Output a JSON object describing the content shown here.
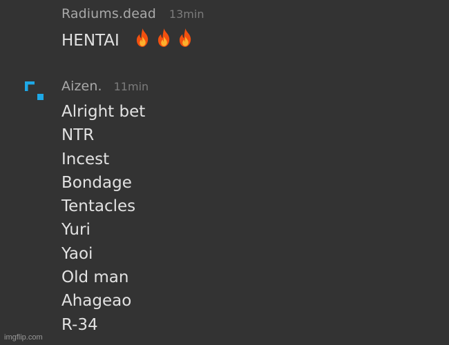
{
  "messages": [
    {
      "author": "Radiums.dead",
      "time": "13min",
      "text": "HENTAI",
      "emoji_icons": [
        "fire-icon",
        "fire-icon",
        "fire-icon"
      ]
    },
    {
      "author": "Aizen.",
      "time": "11min",
      "avatar_icon": "pixel-logo-icon",
      "lines": [
        "Alright bet",
        "NTR",
        "Incest",
        "Bondage",
        "Tentacles",
        "Yuri",
        "Yaoi",
        "Old man",
        "Ahageao",
        "R-34"
      ]
    }
  ],
  "watermark": "imgflip.com",
  "colors": {
    "background": "#333333",
    "author": "#a9a9a9",
    "timestamp": "#7c7c7c",
    "text": "#e2e2e2",
    "avatar_accent": "#1ea8e6"
  }
}
